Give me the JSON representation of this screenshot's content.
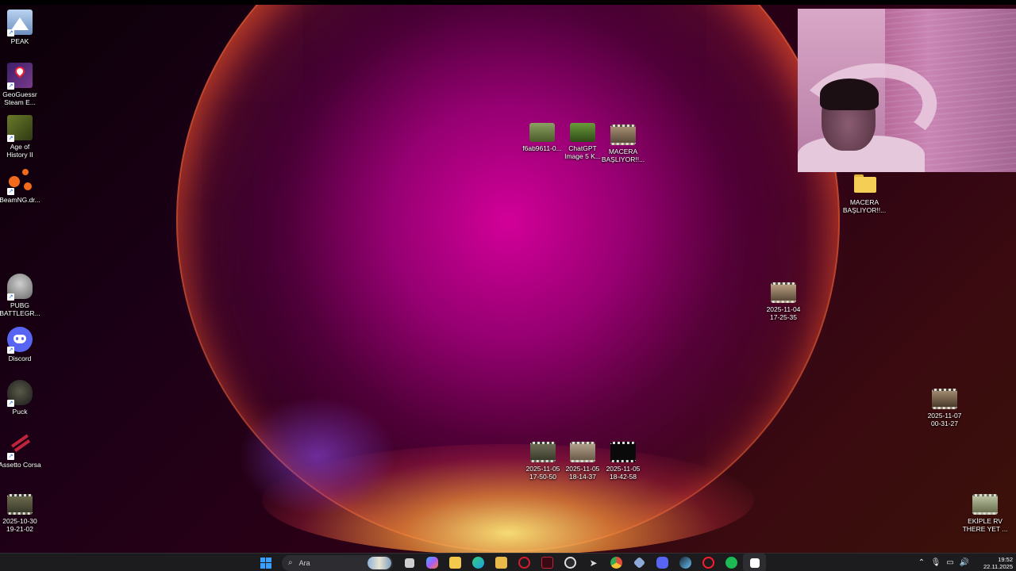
{
  "desktop": {
    "left_icons": [
      {
        "label": "PEAK",
        "icon": "peak-icon",
        "color": "#7fa7d8"
      },
      {
        "label": "GeoGuessr\nSteam E...",
        "icon": "geoguessr-icon",
        "color": "#4a2a7a"
      },
      {
        "label": "Age of\nHistory II",
        "icon": "age-of-history-icon",
        "color": "#5b6a2a"
      },
      {
        "label": "BeamNG.dr...",
        "icon": "beamng-icon",
        "color": "#f26a1b"
      },
      {
        "label": "PUBG\nBATTLEGR...",
        "icon": "pubg-icon",
        "color": "#9a9a9a"
      },
      {
        "label": "Discord",
        "icon": "discord-icon",
        "color": "#5865f2"
      },
      {
        "label": "Puck",
        "icon": "puck-icon",
        "color": "#3a3a3a"
      },
      {
        "label": "Assetto Corsa",
        "icon": "assetto-corsa-icon",
        "color": "#c0243a"
      },
      {
        "label": "2025-10-30\n19-21-02",
        "icon": "video-file-icon",
        "color": "#555"
      }
    ],
    "top_cluster": [
      {
        "label": "f6ab9611-0...",
        "icon": "image-file-icon",
        "color": "#5c7a3a"
      },
      {
        "label": "ChatGPT\nImage 5 K...",
        "icon": "image-file-icon",
        "color": "#4f7a2a"
      },
      {
        "label": "MACERA\nBAŞLIYOR!!...",
        "icon": "video-file-icon",
        "color": "#7a6a55"
      }
    ],
    "folder": {
      "label": "MACERA\nBAŞLIYOR!!...",
      "icon": "folder-icon",
      "color": "#f2c94c"
    },
    "right_video_1": {
      "label": "2025-11-04\n17-25-35",
      "icon": "video-file-icon"
    },
    "right_video_2": {
      "label": "2025-11-07\n00-31-27",
      "icon": "video-file-icon"
    },
    "bottom_cluster": [
      {
        "label": "2025-11-05\n17-50-50",
        "icon": "video-file-icon",
        "color": "#5d5d4a"
      },
      {
        "label": "2025-11-05\n18-14-37",
        "icon": "video-file-icon",
        "color": "#8b7c6a"
      },
      {
        "label": "2025-11-05\n18-42-58",
        "icon": "video-file-icon",
        "color": "#111111"
      }
    ],
    "corner_video": {
      "label": "EKİPLE RV\nTHERE YET ...",
      "icon": "video-file-icon"
    }
  },
  "webcam": {
    "label": "webcam-overlay"
  },
  "taskbar": {
    "search_placeholder": "Ara",
    "apps": [
      {
        "name": "task-view-icon",
        "color": "#cfcfcf"
      },
      {
        "name": "copilot-icon",
        "color": "#7a5cff"
      },
      {
        "name": "file-explorer-icon",
        "color": "#f2c94c"
      },
      {
        "name": "edge-icon",
        "color": "#1b9de2"
      },
      {
        "name": "ms-store-icon",
        "color": "#e9b949"
      },
      {
        "name": "opera-gx-icon",
        "color": "#d91a2a"
      },
      {
        "name": "capcut-icon",
        "color": "#7a1a2a"
      },
      {
        "name": "obs-icon",
        "color": "#3a3a3a"
      },
      {
        "name": "cursor-icon",
        "color": "#dddddd"
      },
      {
        "name": "chrome-icon",
        "color": "#e24b3b"
      },
      {
        "name": "epic-launcher-icon",
        "color": "#8fa9d9"
      },
      {
        "name": "discord-taskbar-icon",
        "color": "#5865f2"
      },
      {
        "name": "steam-icon",
        "color": "#66c0f4"
      },
      {
        "name": "opera-icon",
        "color": "#ff1b2d"
      },
      {
        "name": "spotify-icon",
        "color": "#1db954"
      },
      {
        "name": "capcut-active-icon",
        "color": "#ffffff"
      }
    ],
    "tray": {
      "time": "19:52",
      "date": "22.11.2025"
    }
  }
}
